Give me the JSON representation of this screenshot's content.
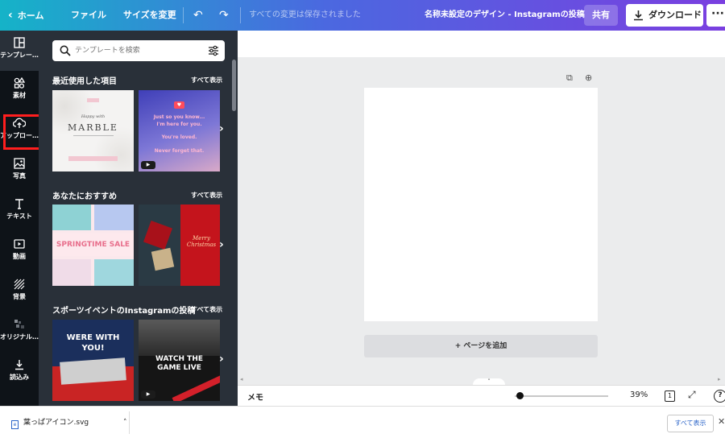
{
  "topbar": {
    "home_label": "ホーム",
    "file_label": "ファイル",
    "resize_label": "サイズを変更",
    "save_status": "すべての変更は保存されました",
    "design_title": "名称未設定のデザイン - Instagramの投稿",
    "share_label": "共有",
    "download_label": "ダウンロード",
    "more_label": "···"
  },
  "sidebar": {
    "items": [
      {
        "label": "テンプレー…",
        "icon": "template-icon"
      },
      {
        "label": "素材",
        "icon": "elements-icon"
      },
      {
        "label": "アップロー…",
        "icon": "upload-cloud-icon"
      },
      {
        "label": "写真",
        "icon": "photo-icon"
      },
      {
        "label": "テキスト",
        "icon": "text-icon"
      },
      {
        "label": "動画",
        "icon": "video-icon"
      },
      {
        "label": "背景",
        "icon": "background-icon"
      },
      {
        "label": "オリジナル…",
        "icon": "original-icon"
      },
      {
        "label": "読込み",
        "icon": "import-icon"
      }
    ]
  },
  "panel": {
    "search_placeholder": "テンプレートを検索",
    "sections": [
      {
        "title": "最近使用した項目",
        "see_all": "すべて表示"
      },
      {
        "title": "あなたにおすすめ",
        "see_all": "すべて表示"
      },
      {
        "title": "スポーツイベントのInstagramの投稿",
        "see_all": "すべて表示"
      }
    ],
    "thumbs": {
      "marble_small": "Happy with",
      "marble_title": "MARBLE",
      "love_l1": "Just so you know...",
      "love_l2": "I'm here for you.",
      "love_l3": "You're loved.",
      "love_l4": "Never forget that.",
      "spring_title": "SPRINGTIME SALE",
      "xmas_title": "Merry Christmas",
      "sport1_l1": "WERE WITH",
      "sport1_l2": "YOU!",
      "sport2_l1": "WATCH THE",
      "sport2_l2": "GAME LIVE"
    }
  },
  "canvas": {
    "add_page_label": "+ ページを追加"
  },
  "bottombar": {
    "memo_label": "メモ",
    "zoom_percent": "39%",
    "zoom_value": 0.05,
    "page_count": "1",
    "help_label": "?"
  },
  "downloads": {
    "file_name": "葉っぱアイコン.svg",
    "show_all_label": "すべて表示"
  }
}
